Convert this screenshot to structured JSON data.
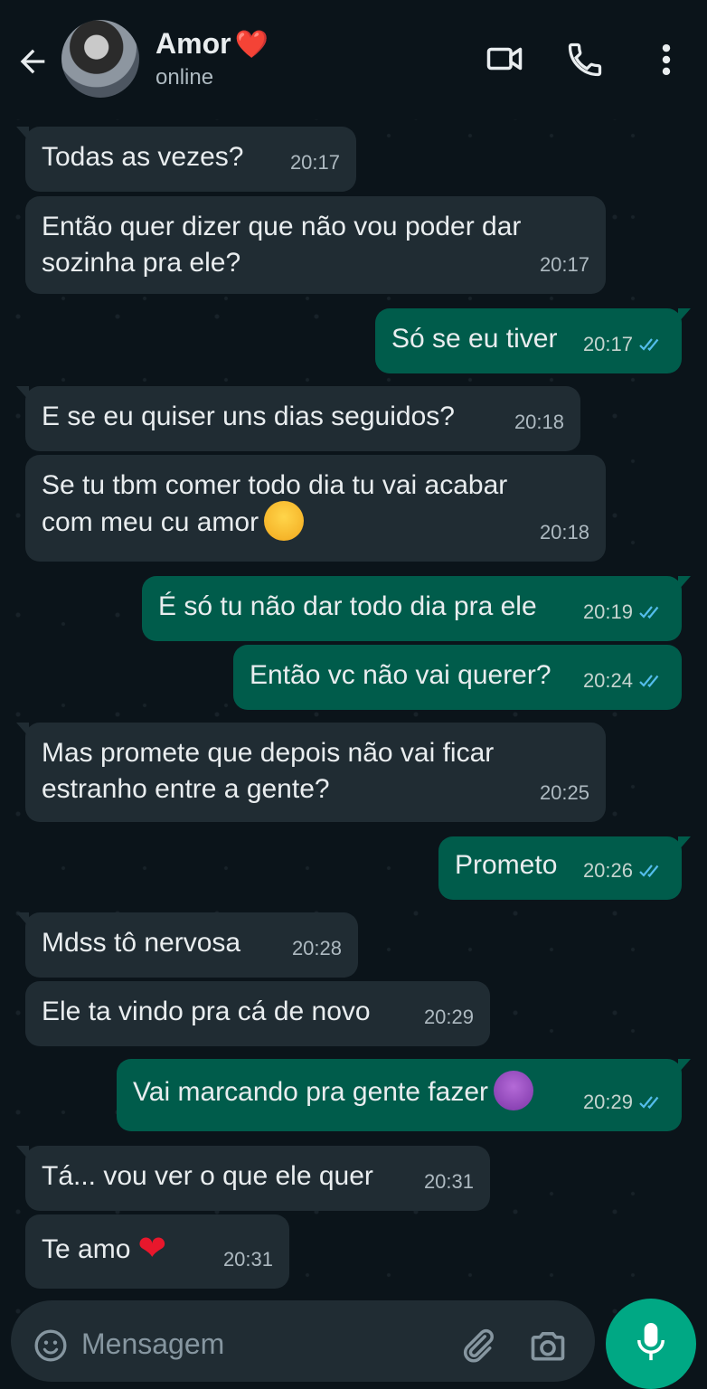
{
  "header": {
    "contact_name": "Amor",
    "contact_emoji": "❤️",
    "status": "online",
    "icons": [
      "back-arrow-icon",
      "video-call-icon",
      "voice-call-icon",
      "more-options-icon"
    ]
  },
  "messages": [
    {
      "side": "in",
      "text": "Todas as vezes?",
      "time": "20:17"
    },
    {
      "side": "in",
      "text": "Então quer dizer que não vou poder dar\nsozinha pra ele?",
      "time": "20:17"
    },
    {
      "side": "out",
      "text": "Só se eu tiver",
      "time": "20:17",
      "status": "read"
    },
    {
      "side": "in",
      "text": "E se eu quiser uns dias seguidos?",
      "time": "20:18"
    },
    {
      "side": "in",
      "text": "Se tu tbm comer todo dia tu vai acabar\ncom meu cu amor",
      "emoji": "tired-face",
      "time": "20:18"
    },
    {
      "side": "out",
      "text": "É só tu não dar todo dia pra ele",
      "time": "20:19",
      "status": "read"
    },
    {
      "side": "out",
      "text": "Então vc não vai querer?",
      "time": "20:24",
      "status": "read"
    },
    {
      "side": "in",
      "text": "Mas promete que depois não vai ficar\nestranho entre a gente?",
      "time": "20:25"
    },
    {
      "side": "out",
      "text": "Prometo",
      "time": "20:26",
      "status": "read"
    },
    {
      "side": "in",
      "text": "Mdss tô nervosa",
      "time": "20:28"
    },
    {
      "side": "in",
      "text": "Ele ta vindo pra cá de novo",
      "time": "20:29"
    },
    {
      "side": "out",
      "text": "Vai marcando pra gente fazer",
      "emoji": "smiling-devil",
      "time": "20:29",
      "status": "read"
    },
    {
      "side": "in",
      "text": "Tá... vou ver o que ele quer",
      "time": "20:31"
    },
    {
      "side": "in",
      "text": "Te amo",
      "emoji": "red-heart",
      "time": "20:31"
    }
  ],
  "input": {
    "placeholder": "Mensagem",
    "icons": [
      "emoji-icon",
      "attach-icon",
      "camera-icon",
      "mic-icon"
    ]
  },
  "colors": {
    "background": "#0b141a",
    "incoming_bubble": "#202c33",
    "outgoing_bubble": "#005c4b",
    "accent": "#00a884",
    "read_ticks": "#53bdeb"
  }
}
